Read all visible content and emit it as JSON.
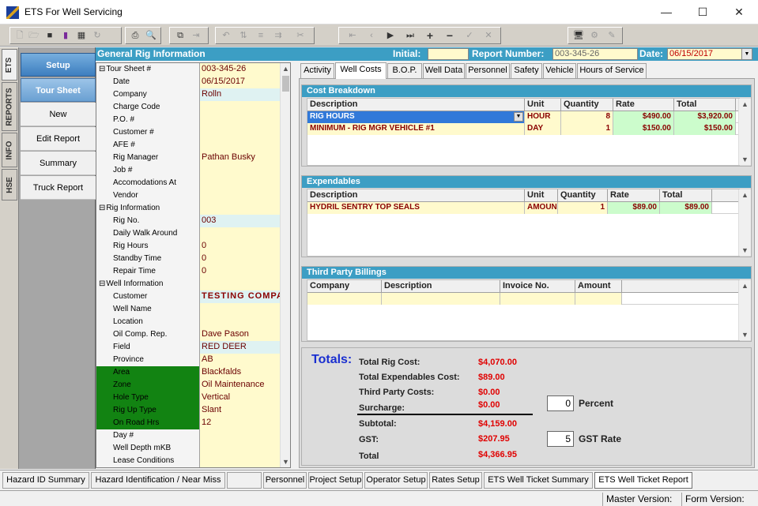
{
  "window": {
    "title": "ETS For Well Servicing",
    "minimize": "—",
    "maximize": "☐",
    "close": "✕"
  },
  "vtabs": [
    "ETS",
    "REPORTS",
    "INFO",
    "HSE"
  ],
  "nav": [
    "Setup",
    "Tour Sheet",
    "New",
    "Edit Report",
    "Summary",
    "Truck Report"
  ],
  "header": {
    "title": "General Rig Information",
    "initial_label": "Initial:",
    "initial_value": "",
    "report_label": "Report Number:",
    "report_value": "003-345-26",
    "date_label": "Date:",
    "date_value": "06/15/2017"
  },
  "grid": [
    {
      "label": "Tour Sheet #",
      "value": "003-345-26",
      "sect": true
    },
    {
      "label": "Date",
      "value": "06/15/2017"
    },
    {
      "label": "Company",
      "value": "Rolln",
      "cyan": true
    },
    {
      "label": "Charge Code",
      "value": ""
    },
    {
      "label": "P.O. #",
      "value": ""
    },
    {
      "label": "Customer #",
      "value": ""
    },
    {
      "label": "AFE #",
      "value": ""
    },
    {
      "label": "Rig Manager",
      "value": "Pathan Busky"
    },
    {
      "label": "Job #",
      "value": ""
    },
    {
      "label": "Accomodations At",
      "value": ""
    },
    {
      "label": "Vendor",
      "value": ""
    },
    {
      "label": "Rig Information",
      "value": "",
      "sect": true
    },
    {
      "label": "Rig No.",
      "value": "003",
      "cyan": true
    },
    {
      "label": "Daily Walk Around",
      "value": ""
    },
    {
      "label": "Rig Hours",
      "value": "0"
    },
    {
      "label": "Standby Time",
      "value": "0"
    },
    {
      "label": "Repair Time",
      "value": "0"
    },
    {
      "label": "Well Information",
      "value": "",
      "sect": true
    },
    {
      "label": "Customer",
      "value": "TESTING COMPA",
      "cyan": true,
      "bold": true
    },
    {
      "label": "Well Name",
      "value": ""
    },
    {
      "label": "Location",
      "value": ""
    },
    {
      "label": "Oil Comp. Rep.",
      "value": "Dave Pason"
    },
    {
      "label": "Field",
      "value": "RED DEER",
      "cyan": true
    },
    {
      "label": "Province",
      "value": "AB"
    },
    {
      "label": "Area",
      "value": "Blackfalds",
      "green": true
    },
    {
      "label": "Zone",
      "value": "Oil Maintenance",
      "green": true
    },
    {
      "label": "Hole Type",
      "value": "Vertical",
      "green": true
    },
    {
      "label": "Rig Up Type",
      "value": "Slant",
      "green": true
    },
    {
      "label": "On Road Hrs",
      "value": "12",
      "green": true
    },
    {
      "label": "Day #",
      "value": ""
    },
    {
      "label": "Well Depth mKB",
      "value": ""
    },
    {
      "label": "Lease Conditions",
      "value": ""
    }
  ],
  "tabs": [
    "Activity",
    "Well Costs",
    "B.O.P.",
    "Well Data",
    "Personnel",
    "Safety",
    "Vehicle",
    "Hours of Service"
  ],
  "cost": {
    "title": "Cost Breakdown",
    "headers": [
      "Description",
      "Unit",
      "Quantity",
      "Rate",
      "Total"
    ],
    "rows": [
      [
        "RIG HOURS",
        "HOUR",
        "8",
        "$490.00",
        "$3,920.00"
      ],
      [
        "MINIMUM - RIG MGR VEHICLE #1",
        "DAY",
        "1",
        "$150.00",
        "$150.00"
      ]
    ]
  },
  "exp": {
    "title": "Expendables",
    "headers": [
      "Description",
      "Unit",
      "Quantity",
      "Rate",
      "Total"
    ],
    "rows": [
      [
        "HYDRIL SENTRY TOP SEALS",
        "AMOUN",
        "1",
        "$89.00",
        "$89.00"
      ]
    ]
  },
  "third": {
    "title": "Third Party Billings",
    "headers": [
      "Company",
      "Description",
      "Invoice No.",
      "Amount"
    ]
  },
  "totals": {
    "title": "Totals:",
    "items": [
      [
        "Total Rig Cost:",
        "$4,070.00"
      ],
      [
        "Total Expendables Cost:",
        "$89.00"
      ],
      [
        "Third Party Costs:",
        "$0.00"
      ],
      [
        "Surcharge:",
        "$0.00"
      ],
      [
        "Subtotal:",
        "$4,159.00"
      ],
      [
        "GST:",
        "$207.95"
      ],
      [
        "Total",
        "$4,366.95"
      ]
    ],
    "percent_value": "0",
    "percent_label": "Percent",
    "gst_value": "5",
    "gst_label": "GST Rate"
  },
  "bottom_tabs": [
    "Hazard ID Summary",
    "Hazard Identification / Near Miss",
    "",
    "Personnel",
    "Project Setup",
    "Operator Setup",
    "Rates Setup",
    "ETS Well Ticket Summary",
    "ETS Well Ticket Report"
  ],
  "status": {
    "master": "Master Version:",
    "form": "Form Version:"
  },
  "colors": {
    "header": "#3c9ec4",
    "value_bg": "#fffacd",
    "value_text": "#8a0000",
    "totals_red": "#e00000",
    "grid_green": "#128312"
  }
}
